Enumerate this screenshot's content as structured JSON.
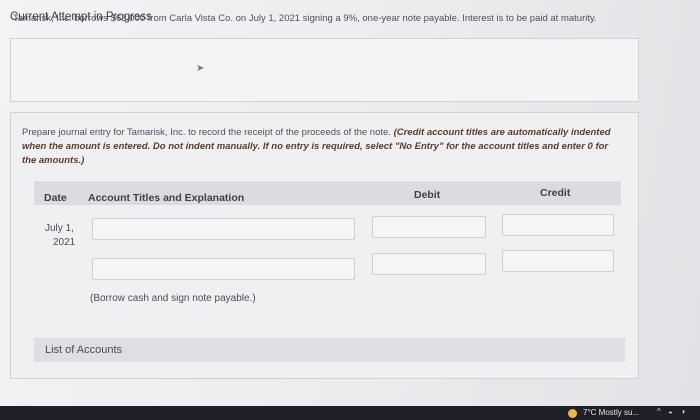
{
  "header": {
    "attempt_title": "Current Attempt in Progress"
  },
  "problem": {
    "text": "Tamarisk, Inc. borrows $63,000 from Carla Vista Co. on July 1, 2021 signing a 9%, one-year note payable. Interest is to be paid at maturity."
  },
  "instructions": {
    "text": "Prepare journal entry for Tamarisk, Inc. to record the receipt of the proceeds of the note. ",
    "emphasis": "(Credit account titles are automatically indented when the amount is entered. Do not indent manually. If no entry is required, select \"No Entry\" for the account titles and enter 0 for the amounts.)"
  },
  "table": {
    "headers": {
      "date": "Date",
      "account": "Account Titles and Explanation",
      "debit": "Debit",
      "credit": "Credit"
    },
    "entry": {
      "date_line1": "July 1,",
      "date_line2": "2021",
      "explanation": "(Borrow cash and sign note payable.)",
      "rows": [
        {
          "account": "",
          "debit": "",
          "credit": ""
        },
        {
          "account": "",
          "debit": "",
          "credit": ""
        }
      ]
    }
  },
  "list_of_accounts": {
    "label": "List of Accounts"
  },
  "taskbar": {
    "weather": "7°C  Mostly su..."
  },
  "icons": {
    "cursor": "pointer-cursor-icon",
    "tray_up": "chevron-up-icon",
    "network": "network-icon"
  }
}
